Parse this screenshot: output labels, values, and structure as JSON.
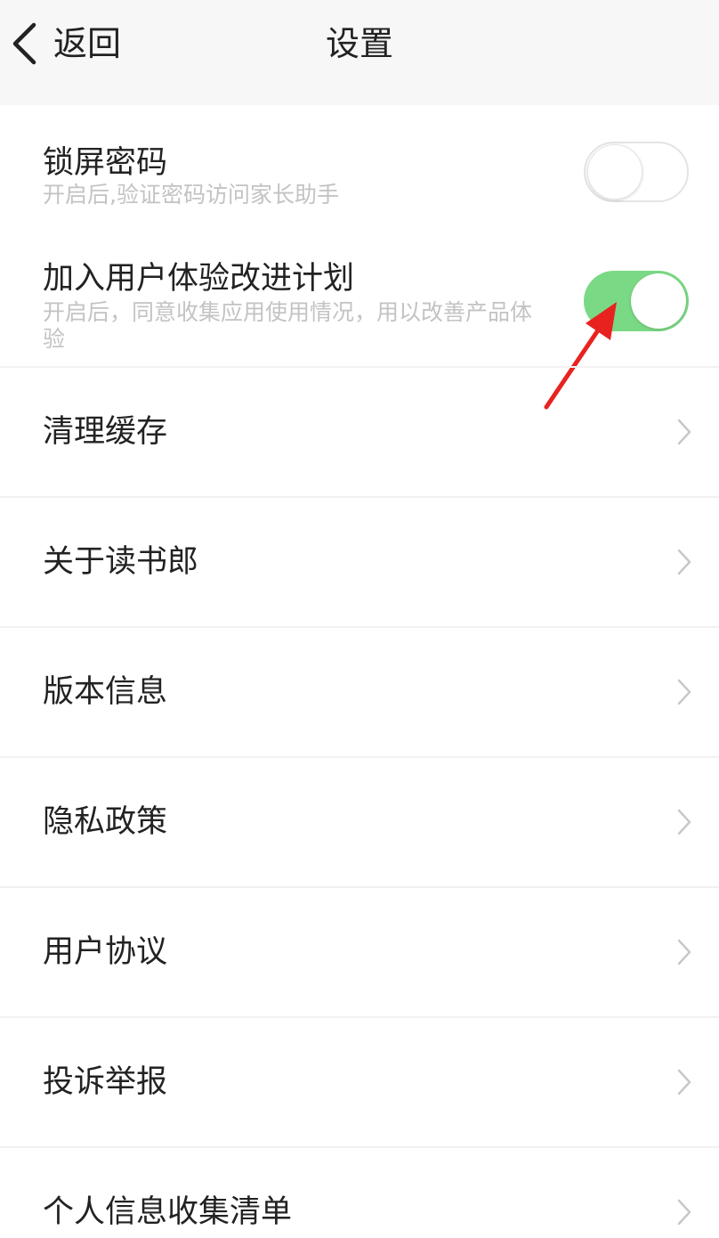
{
  "header": {
    "back_label": "返回",
    "title": "设置"
  },
  "toggles": [
    {
      "title": "锁屏密码",
      "subtitle": "开启后,验证密码访问家长助手",
      "enabled": false
    },
    {
      "title": "加入用户体验改进计划",
      "subtitle": "开启后，同意收集应用使用情况，用以改善产品体验",
      "enabled": true
    }
  ],
  "menu_items": [
    {
      "label": "清理缓存"
    },
    {
      "label": "关于读书郎"
    },
    {
      "label": "版本信息"
    },
    {
      "label": "隐私政策"
    },
    {
      "label": "用户协议"
    },
    {
      "label": "投诉举报"
    },
    {
      "label": "个人信息收集清单"
    }
  ],
  "colors": {
    "toggle_on": "#7ad984",
    "annotation_arrow": "#e8231f",
    "subtitle_text": "#c3c3c3"
  },
  "icons": {
    "back": "chevron-left-icon",
    "row_arrow": "chevron-right-icon",
    "annotation": "red-arrow-annotation"
  }
}
